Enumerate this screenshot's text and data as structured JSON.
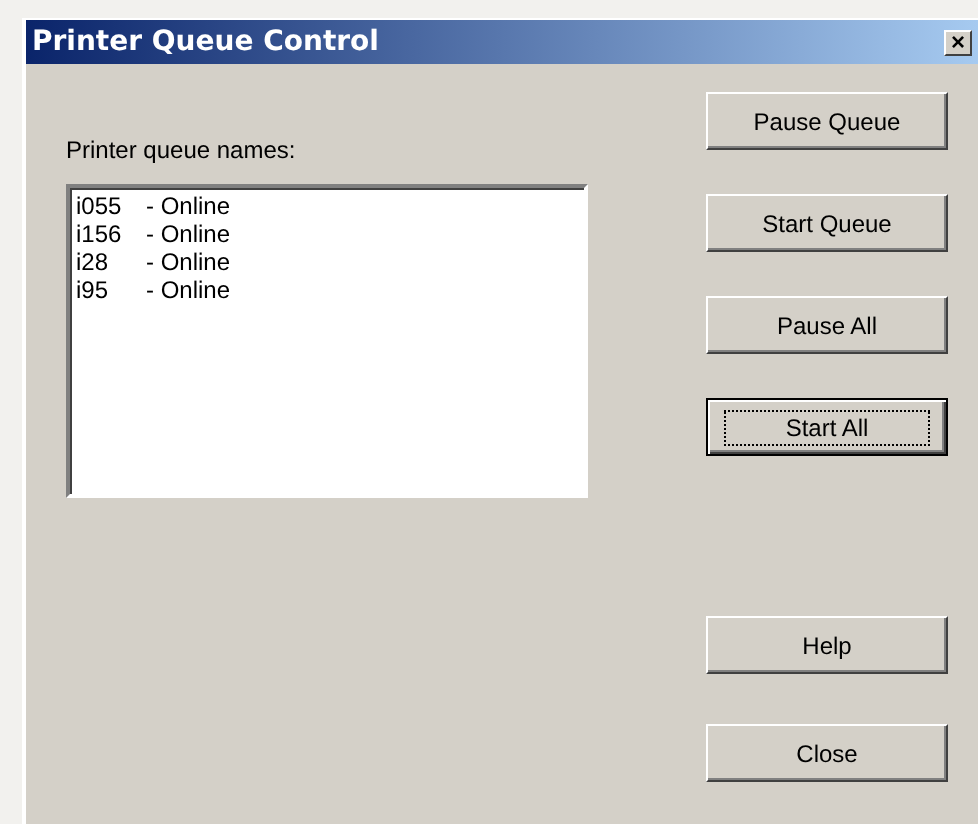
{
  "window": {
    "title": "Printer Queue Control",
    "close_glyph": "×"
  },
  "queue_list": {
    "label": "Printer queue names:",
    "items": [
      {
        "name": "i055",
        "status": "- Online"
      },
      {
        "name": "i156",
        "status": "- Online"
      },
      {
        "name": "i28",
        "status": "- Online"
      },
      {
        "name": "i95",
        "status": "- Online"
      }
    ]
  },
  "buttons": [
    {
      "label": "Pause Queue",
      "default": false
    },
    {
      "label": "Start Queue",
      "default": false
    },
    {
      "label": "Pause All",
      "default": false
    },
    {
      "label": "Start All",
      "default": true
    }
  ],
  "bottom_buttons": [
    {
      "label": "Help",
      "default": false
    },
    {
      "label": "Close",
      "default": false
    }
  ]
}
